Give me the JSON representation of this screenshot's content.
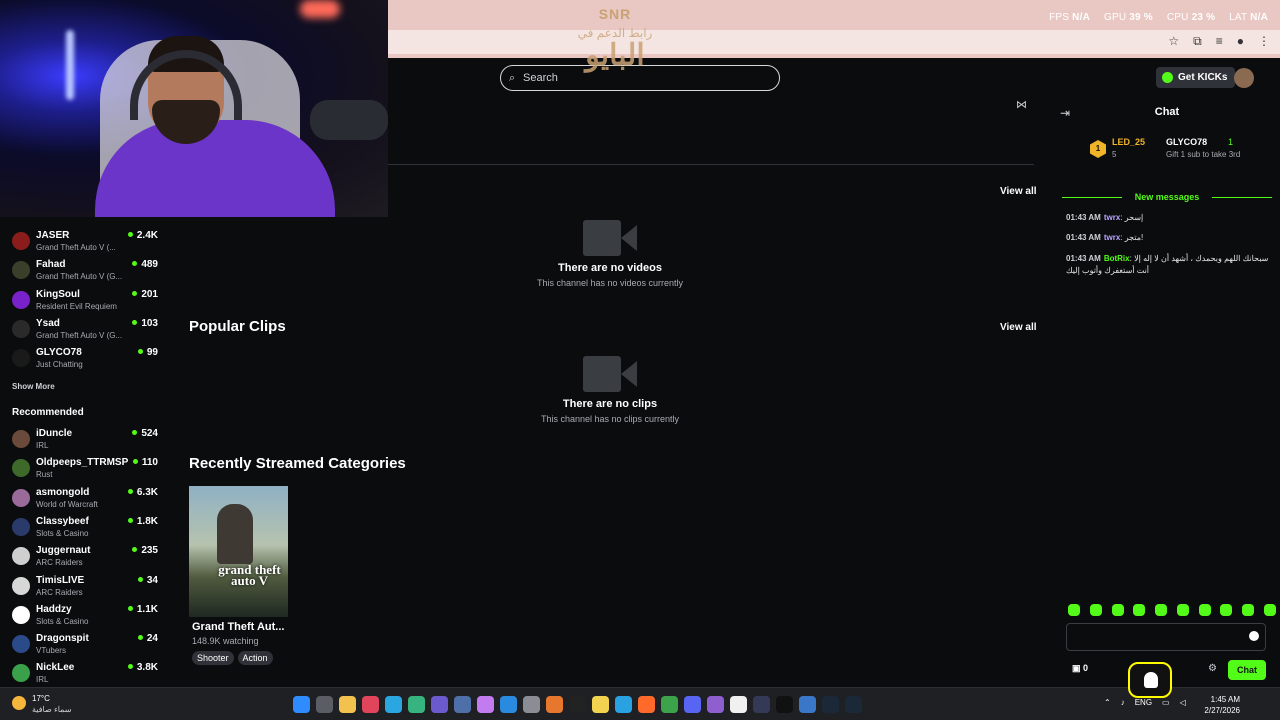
{
  "stats": {
    "fps_label": "FPS",
    "fps_value": "N/A",
    "gpu_label": "GPU",
    "gpu_value": "39 %",
    "cpu_label": "CPU",
    "cpu_value": "23 %",
    "lat_label": "LAT",
    "lat_value": "N/A"
  },
  "header": {
    "search_placeholder": "Search",
    "get_kicks": "Get KICKs"
  },
  "sidebar": {
    "following": [
      {
        "name": "JASER",
        "category": "Grand Theft Auto V (...",
        "viewers": "2.4K",
        "color": "#8b1c1c"
      },
      {
        "name": "Fahad",
        "category": "Grand Theft Auto V (G...",
        "viewers": "489",
        "color": "#3a3f2a"
      },
      {
        "name": "KingSoul",
        "category": "Resident Evil Requiem",
        "viewers": "201",
        "color": "#7a22c9"
      },
      {
        "name": "Ysad",
        "category": "Grand Theft Auto V (G...",
        "viewers": "103",
        "color": "#2a2a2a"
      },
      {
        "name": "GLYCO78",
        "category": "Just Chatting",
        "viewers": "99",
        "color": "#1a1a1a"
      }
    ],
    "show_more": "Show More",
    "recommended_label": "Recommended",
    "recommended": [
      {
        "name": "iDuncle",
        "category": "IRL",
        "viewers": "524",
        "color": "#6a4a3a"
      },
      {
        "name": "Oldpeeps_TTRMSP",
        "category": "Rust",
        "viewers": "110",
        "color": "#3d6a2a"
      },
      {
        "name": "asmongold",
        "category": "World of Warcraft",
        "viewers": "6.3K",
        "color": "#9a6a9a"
      },
      {
        "name": "Classybeef",
        "category": "Slots & Casino",
        "viewers": "1.8K",
        "color": "#2a3a6a"
      },
      {
        "name": "Juggernaut",
        "category": "ARC Raiders",
        "viewers": "235",
        "color": "#cfcfcf"
      },
      {
        "name": "TimisLIVE",
        "category": "ARC Raiders",
        "viewers": "34",
        "color": "#d7d7d7"
      },
      {
        "name": "Haddzy",
        "category": "Slots & Casino",
        "viewers": "1.1K",
        "color": "#ffffff"
      },
      {
        "name": "Dragonspit",
        "category": "VTubers",
        "viewers": "24",
        "color": "#2a4a8a"
      },
      {
        "name": "NickLee",
        "category": "IRL",
        "viewers": "3.8K",
        "color": "#3aa04a"
      }
    ]
  },
  "main": {
    "view_all": "View all",
    "videos_empty_title": "There are no videos",
    "videos_empty_desc": "This channel has no videos currently",
    "popular_clips": "Popular Clips",
    "clips_empty_title": "There are no clips",
    "clips_empty_desc": "This channel has no clips currently",
    "recent_categories": "Recently Streamed Categories",
    "category": {
      "title": "Grand Theft Aut...",
      "watching": "148.9K watching",
      "tags": [
        "Shooter",
        "Action"
      ],
      "cover_text": "grand theft auto V"
    }
  },
  "chat": {
    "title": "Chat",
    "leader_rank": "1",
    "leader1_name": "LED_25",
    "leader1_count": "5",
    "leader2_name": "GLYCO78",
    "leader2_count": "1",
    "gift_text": "Gift 1 sub to take 3rd",
    "new_messages": "New messages",
    "messages": [
      {
        "time": "01:43 AM",
        "user": "twrx",
        "text": "إسحر"
      },
      {
        "time": "01:43 AM",
        "user": "twrx",
        "text": "متجر!"
      },
      {
        "time": "01:43 AM",
        "user": "BotRix",
        "text": "سبحانك اللهم وبحمدك ، أشهد أن لا إله إلا أنت أستغفرك وأتوب إليك"
      }
    ],
    "points": "0",
    "send_label": "Chat"
  },
  "overlay": {
    "logo_top": "SNR",
    "logo_line": "رابط الدعم في",
    "logo_big": "البايو"
  },
  "taskbar": {
    "temp": "17°C",
    "weather_desc": "سماء صافية",
    "lang": "ENG",
    "time": "1:45 AM",
    "date": "2/27/2026"
  }
}
